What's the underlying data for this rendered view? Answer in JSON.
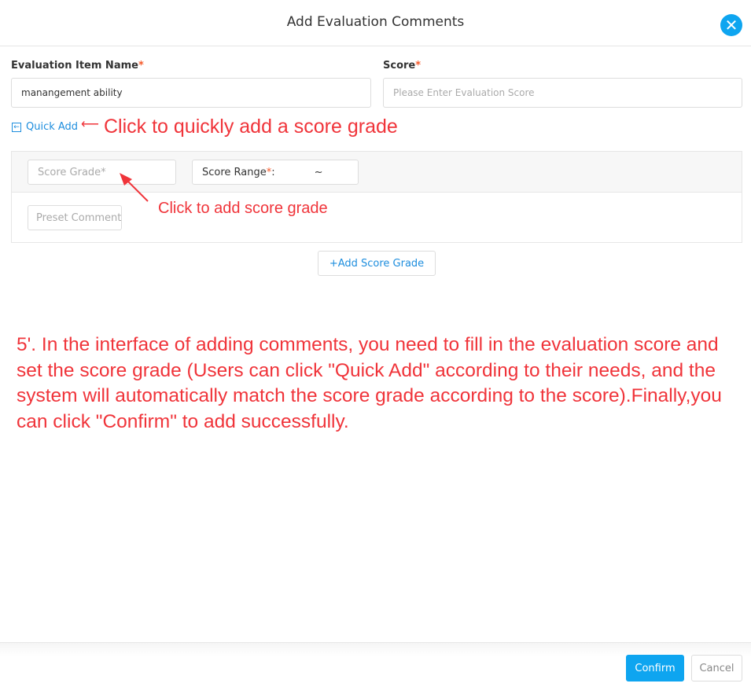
{
  "dialog": {
    "title": "Add Evaluation Comments",
    "close_icon": "close-circle-icon"
  },
  "form": {
    "item_name_label": "Evaluation Item Name",
    "required_mark": "*",
    "item_name_value": "manangement ability",
    "score_label": "Score",
    "score_placeholder": "Please Enter Evaluation Score",
    "quick_add": "Quick Add",
    "score_grade_placeholder": "Score Grade*",
    "score_range_label": "Score Range",
    "score_range_sep": ":",
    "score_range_tilde": "~",
    "preset_comment_placeholder": "Preset Comment",
    "add_score_grade": "+Add Score Grade"
  },
  "annotations": {
    "quick_add_note": "Click to quickly add a score grade",
    "score_grade_note": "Click to add score grade",
    "instructions": "5'. In the interface of adding comments, you need to fill in the evaluation score and set the score grade (Users can click \"Quick Add\" according to their needs, and the system will automatically match the score grade according to the score).Finally,you can click \"Confirm\" to add successfully.",
    "color": "#f0343a"
  },
  "footer": {
    "confirm": "Confirm",
    "cancel": "Cancel",
    "accent": "#0ea5f0"
  }
}
